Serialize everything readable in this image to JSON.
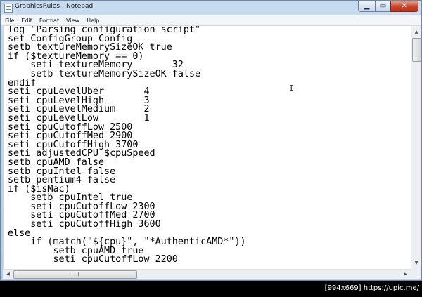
{
  "window": {
    "title": "GraphicsRules - Notepad"
  },
  "menu": [
    "File",
    "Edit",
    "Format",
    "View",
    "Help"
  ],
  "editor": {
    "lines": [
      "log \"Parsing configuration script\"",
      "set ConfigGroup Config",
      "setb textureMemorySizeOK true",
      "if ($textureMemory == 0)",
      "    seti textureMemory       32",
      "    setb textureMemorySizeOK false",
      "endif",
      "seti cpuLevelUber       4",
      "seti cpuLevelHigh       3",
      "seti cpuLevelMedium     2",
      "seti cpuLevelLow        1",
      "seti cpuCutoffLow 2500",
      "seti cpuCutoffMed 2900",
      "seti cpuCutoffHigh 3700",
      "seti adjustedCPU $cpuSpeed",
      "setb cpuAMD false",
      "setb cpuIntel false",
      "setb pentium4 false",
      "if ($isMac)",
      "    setb cpuIntel true",
      "    seti cpuCutoffLow 2300",
      "    seti cpuCutoffMed 2700",
      "    seti cpuCutoffHigh 3600",
      "else",
      "    if (match(\"${cpu}\", \"*AuthenticAMD*\"))",
      "        setb cpuAMD true",
      "        seti cpuCutoffLow 2200"
    ]
  },
  "icons": {
    "app": "notepad-icon",
    "minimize": "minimize-icon",
    "maximize": "maximize-icon",
    "close": "close-icon",
    "scroll_up": "arrow-up-icon",
    "scroll_down": "arrow-down-icon",
    "scroll_left": "arrow-left-icon",
    "scroll_right": "arrow-right-icon"
  },
  "watermark": "[994x669] https://upic.me/"
}
